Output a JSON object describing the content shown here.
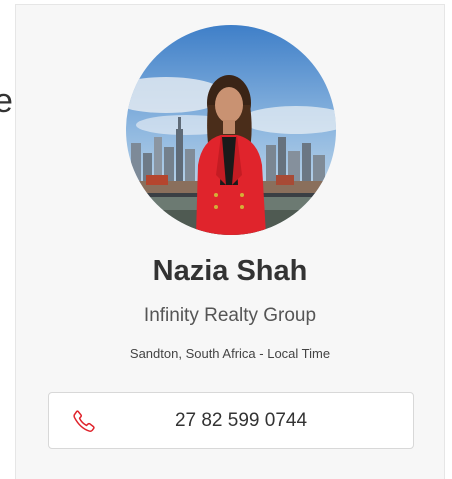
{
  "agent": {
    "name": "Nazia Shah",
    "company": "Infinity Realty Group",
    "location": "Sandton, South Africa - Local Time",
    "phone": "27 82 599 0744"
  },
  "edge_text": "e",
  "icons": {
    "phone": "phone-icon"
  },
  "colors": {
    "accent": "#e0242c",
    "card_background": "#f7f7f7",
    "text": "#333333"
  }
}
